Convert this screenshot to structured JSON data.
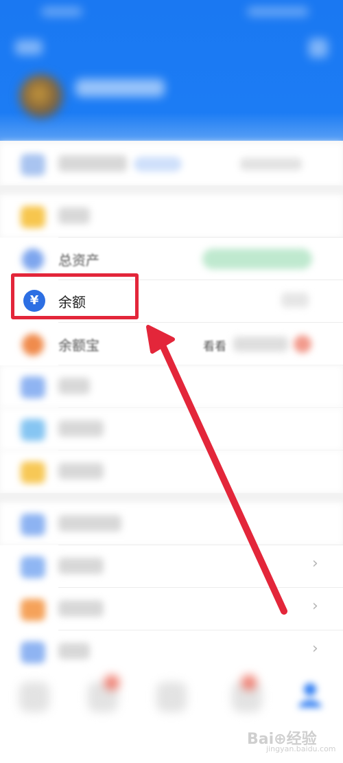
{
  "rows": {
    "total_assets": {
      "label": "总资产"
    },
    "balance": {
      "label": "余额",
      "icon_glyph": "¥"
    },
    "yu_e_bao": {
      "label": "余额宝",
      "hint": "看看"
    }
  },
  "list": {
    "chevron": "›"
  },
  "watermark": {
    "brand": "Bai⊕经验",
    "url": "jingyan.baidu.com"
  },
  "colors": {
    "header_blue": "#1c7cf4",
    "highlight_red": "#e3263a",
    "arrow_red": "#e3263a",
    "balance_icon_blue": "#2d6fe3"
  },
  "icons": {
    "balance": "yuan-icon",
    "user_tab": "person-icon"
  }
}
